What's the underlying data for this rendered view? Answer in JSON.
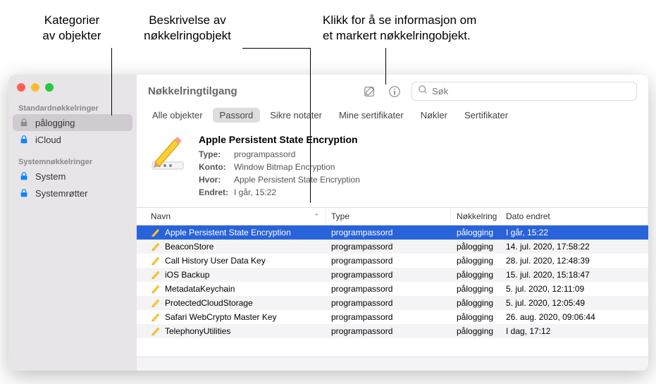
{
  "callouts": {
    "cat": "Kategorier\nav objekter",
    "desc": "Beskrivelse av\nnøkkelringobjekt",
    "info": "Klikk for å se informasjon om\net markert nøkkelringobjekt."
  },
  "window": {
    "title": "Nøkkelringtilgang",
    "search_placeholder": "Søk"
  },
  "sidebar": {
    "section1": "Standardnøkkelringer",
    "section2": "Systemnøkkelringer",
    "items1": [
      "pålogging",
      "iCloud"
    ],
    "items2": [
      "System",
      "Systemrøtter"
    ]
  },
  "tabs": [
    "Alle objekter",
    "Passord",
    "Sikre notater",
    "Mine sertifikater",
    "Nøkler",
    "Sertifikater"
  ],
  "detail": {
    "title": "Apple Persistent State Encryption",
    "labels": {
      "type": "Type:",
      "account": "Konto:",
      "where": "Hvor:",
      "modified": "Endret:"
    },
    "values": {
      "type": "programpassord",
      "account": "Window Bitmap Encryption",
      "where": "Apple Persistent State Encryption",
      "modified": "I går, 15:22"
    }
  },
  "table": {
    "headers": {
      "name": "Navn",
      "type": "Type",
      "ring": "Nøkkelring",
      "date": "Dato endret"
    },
    "rows": [
      {
        "name": "Apple Persistent State Encryption",
        "type": "programpassord",
        "ring": "pålogging",
        "date": "I går, 15:22",
        "selected": true
      },
      {
        "name": "BeaconStore",
        "type": "programpassord",
        "ring": "pålogging",
        "date": "14. jul. 2020, 17:58:22"
      },
      {
        "name": "Call History User Data Key",
        "type": "programpassord",
        "ring": "pålogging",
        "date": "28. jul. 2020, 12:48:39"
      },
      {
        "name": "iOS Backup",
        "type": "programpassord",
        "ring": "pålogging",
        "date": "15. jul. 2020, 15:18:47"
      },
      {
        "name": "MetadataKeychain",
        "type": "programpassord",
        "ring": "pålogging",
        "date": "5. jul. 2020, 12:11:09"
      },
      {
        "name": "ProtectedCloudStorage",
        "type": "programpassord",
        "ring": "pålogging",
        "date": "5. jul. 2020, 12:05:49"
      },
      {
        "name": "Safari WebCrypto Master Key",
        "type": "programpassord",
        "ring": "pålogging",
        "date": "26. aug. 2020, 09:06:44"
      },
      {
        "name": "TelephonyUtilities",
        "type": "programpassord",
        "ring": "pålogging",
        "date": "I dag, 17:12"
      }
    ]
  }
}
